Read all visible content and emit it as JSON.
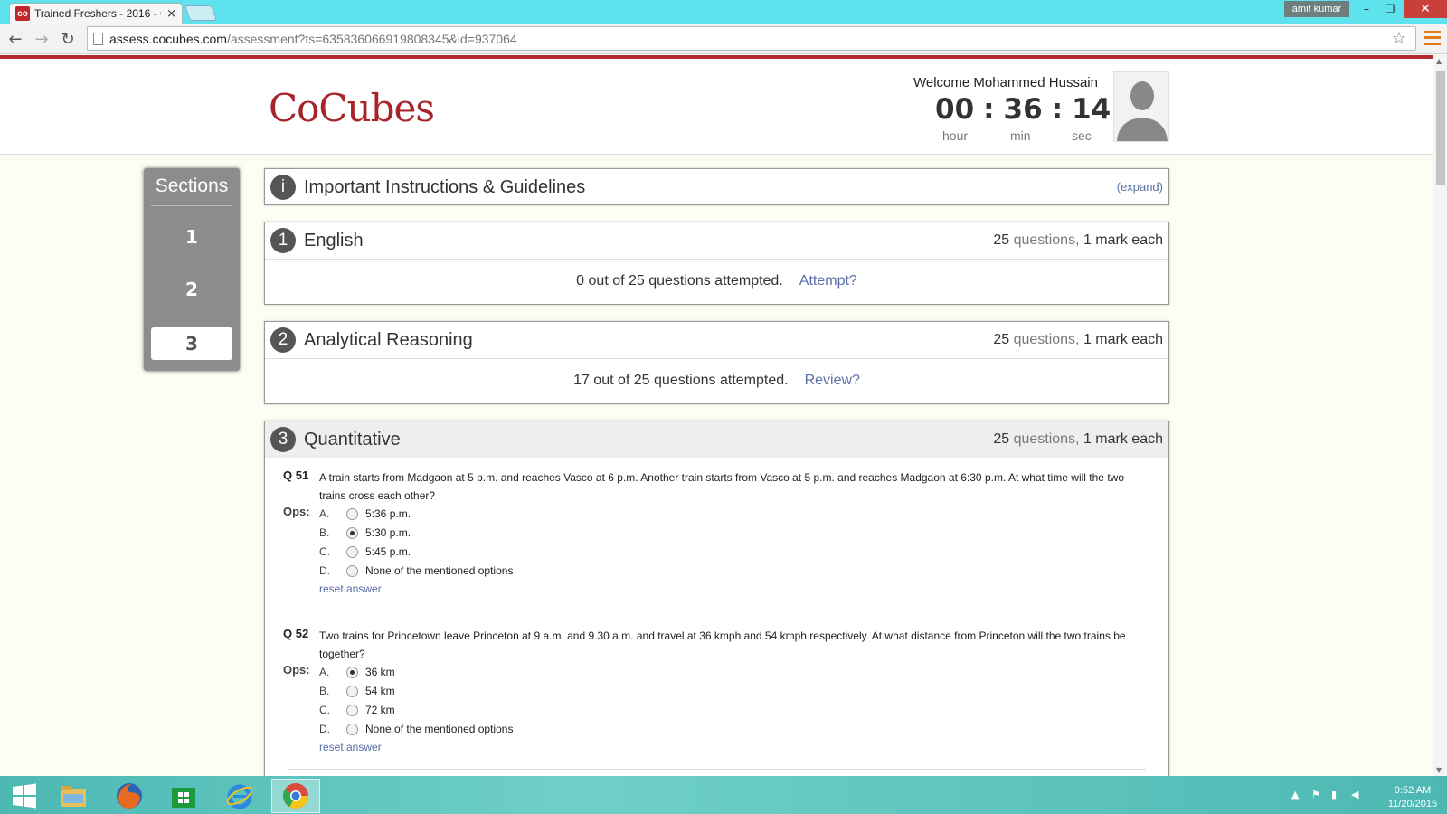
{
  "browser": {
    "tab_title": "Trained Freshers - 2016 - C",
    "tab_favicon": "co",
    "tab_close": "×",
    "user_badge": "amit kumar",
    "url_host": "assess.cocubes.com",
    "url_path": "/assessment?ts=635836066919808345&id=937064",
    "win_minimize": "–",
    "win_restore": "❐",
    "win_close": "✕",
    "nav_back": "←",
    "nav_forward": "→",
    "nav_reload": "↻",
    "star": "☆"
  },
  "header": {
    "logo": "CoCubes",
    "welcome": "Welcome Mohammed Hussain",
    "timer": {
      "hour": "00",
      "min": "36",
      "sec": "14",
      "sep": ":"
    },
    "timer_labels": {
      "hour": "hour",
      "min": "min",
      "sec": "sec"
    }
  },
  "sidebar": {
    "title": "Sections",
    "items": [
      {
        "label": "1"
      },
      {
        "label": "2"
      },
      {
        "label": "3"
      }
    ],
    "active": "3"
  },
  "instructions": {
    "icon": "i",
    "title": "Important Instructions & Guidelines",
    "expand": "(expand)"
  },
  "sections": [
    {
      "num": "1",
      "title": "English",
      "count": "25",
      "questions_word": "questions,",
      "marks": "1 mark each",
      "status": "0 out of 25 questions attempted.",
      "action": "Attempt?"
    },
    {
      "num": "2",
      "title": "Analytical Reasoning",
      "count": "25",
      "questions_word": "questions,",
      "marks": "1 mark each",
      "status": "17 out of 25 questions attempted.",
      "action": "Review?"
    },
    {
      "num": "3",
      "title": "Quantitative",
      "count": "25",
      "questions_word": "questions,",
      "marks": "1 mark each"
    }
  ],
  "questions": [
    {
      "num": "Q 51",
      "text": "A train starts from Madgaon at 5 p.m. and reaches Vasco at 6 p.m. Another train starts from Vasco at 5 p.m. and reaches Madgaon at 6:30 p.m. At what time will the two trains cross each other?",
      "ops_label": "Ops:",
      "options": [
        {
          "letter": "A.",
          "text": "5:36 p.m.",
          "selected": false
        },
        {
          "letter": "B.",
          "text": "5:30 p.m.",
          "selected": true
        },
        {
          "letter": "C.",
          "text": "5:45 p.m.",
          "selected": false
        },
        {
          "letter": "D.",
          "text": "None of the mentioned options",
          "selected": false
        }
      ],
      "reset": "reset answer"
    },
    {
      "num": "Q 52",
      "text": "Two trains for Princetown leave Princeton at 9 a.m. and 9.30 a.m. and travel at 36 kmph and 54 kmph respectively. At what distance from Princeton will the two trains be together?",
      "ops_label": "Ops:",
      "options": [
        {
          "letter": "A.",
          "text": "36 km",
          "selected": true
        },
        {
          "letter": "B.",
          "text": "54 km",
          "selected": false
        },
        {
          "letter": "C.",
          "text": "72 km",
          "selected": false
        },
        {
          "letter": "D.",
          "text": "None of the mentioned options",
          "selected": false
        }
      ],
      "reset": "reset answer"
    }
  ],
  "taskbar": {
    "apps": [
      "start-icon",
      "file-explorer-icon",
      "firefox-icon",
      "store-icon",
      "internet-explorer-icon",
      "chrome-icon"
    ],
    "clock_time": "9:52 AM",
    "clock_date": "11/20/2015"
  },
  "colors": {
    "brand": "#a8242b",
    "link": "#5a6ea8",
    "titlebar": "#5ee3ee"
  }
}
